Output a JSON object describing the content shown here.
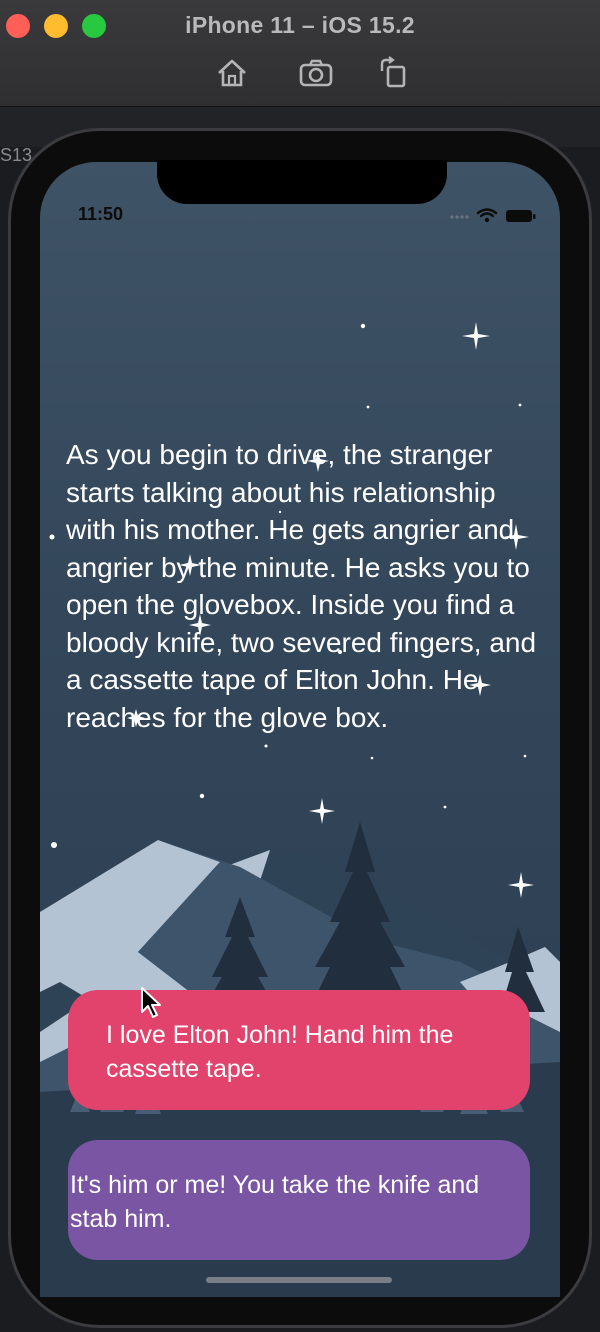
{
  "simulator": {
    "title": "iPhone 11 – iOS 15.2",
    "toolbar_buttons": [
      "home-icon",
      "screenshot-icon",
      "rotate-icon"
    ]
  },
  "edge_text": "S13",
  "status_bar": {
    "time": "11:50",
    "icons": [
      "signal-icon",
      "wifi-icon",
      "battery-icon"
    ]
  },
  "story": {
    "text": "As you begin to drive, the stranger starts talking about his relationship with his mother. He gets angrier and angrier by the minute. He asks you to open the glovebox. Inside you find a bloody knife, two severed fingers, and a cassette tape of Elton John. He reaches for the glove box."
  },
  "choices": [
    {
      "label": "I love Elton John! Hand him the cassette tape.",
      "color": "#e2436c"
    },
    {
      "label": "It's him or me! You take the knife and stab him.",
      "color": "#7a55a3"
    }
  ],
  "colors": {
    "sky_top": "#3f5366",
    "sky_bottom": "#2b3d50",
    "mountain_light": "#b4c3d3",
    "mountain_mid": "#425a72",
    "tree_dark": "#212e3d"
  }
}
